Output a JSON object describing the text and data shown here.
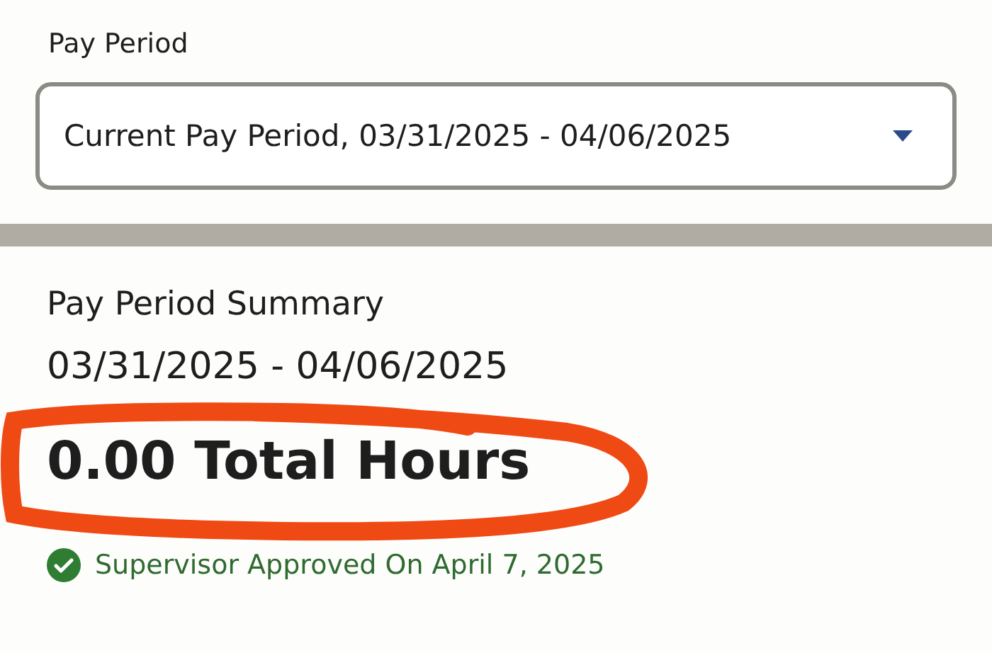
{
  "pay_period": {
    "label": "Pay Period",
    "select": {
      "value": "Current Pay Period, 03/31/2025 - 04/06/2025"
    }
  },
  "summary": {
    "title": "Pay Period Summary",
    "date_range": "03/31/2025 - 04/06/2025",
    "total_hours": "0.00 Total Hours",
    "status": {
      "text": "Supervisor Approved On April 7, 2025",
      "approved": true
    }
  }
}
